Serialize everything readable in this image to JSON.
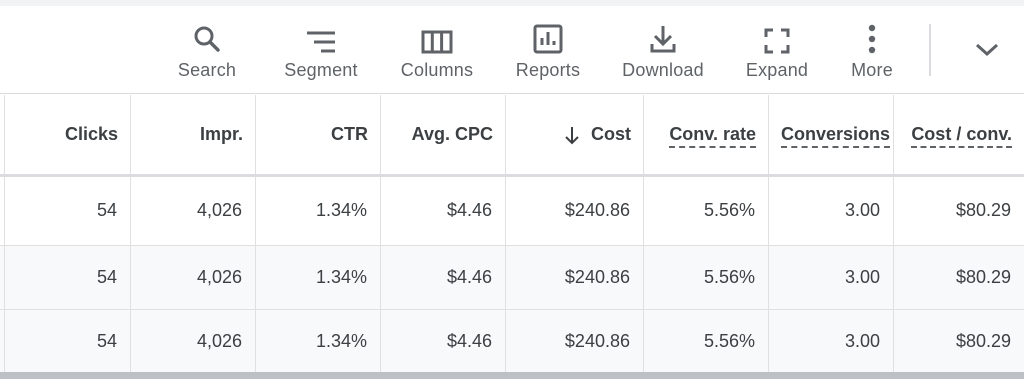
{
  "toolbar": {
    "search_label": "Search",
    "segment_label": "Segment",
    "columns_label": "Columns",
    "reports_label": "Reports",
    "download_label": "Download",
    "expand_label": "Expand",
    "more_label": "More"
  },
  "table": {
    "headers": {
      "clicks": "Clicks",
      "impr": "Impr.",
      "ctr": "CTR",
      "avg_cpc": "Avg. CPC",
      "cost": "Cost",
      "conv_rate": "Conv. rate",
      "conversions": "Conversions",
      "cost_per_conv": "Cost / conv."
    },
    "sort": {
      "column": "cost",
      "direction": "descending",
      "icon": "arrow-down-icon"
    },
    "rows": [
      {
        "clicks": "54",
        "impr": "4,026",
        "ctr": "1.34%",
        "avg_cpc": "$4.46",
        "cost": "$240.86",
        "conv_rate": "5.56%",
        "conversions": "3.00",
        "cost_per_conv": "$80.29"
      },
      {
        "clicks": "54",
        "impr": "4,026",
        "ctr": "1.34%",
        "avg_cpc": "$4.46",
        "cost": "$240.86",
        "conv_rate": "5.56%",
        "conversions": "3.00",
        "cost_per_conv": "$80.29"
      },
      {
        "clicks": "54",
        "impr": "4,026",
        "ctr": "1.34%",
        "avg_cpc": "$4.46",
        "cost": "$240.86",
        "conv_rate": "5.56%",
        "conversions": "3.00",
        "cost_per_conv": "$80.29"
      }
    ]
  },
  "colors": {
    "text": "#3c4043",
    "icon": "#5f6368",
    "border": "#dadce0",
    "row_alt": "#f8f9fa"
  }
}
